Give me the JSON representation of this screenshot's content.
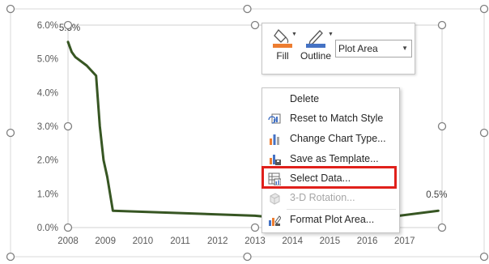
{
  "chart_data": {
    "type": "line",
    "x": [
      2008.0,
      2008.1,
      2008.2,
      2008.5,
      2008.75,
      2008.85,
      2008.95,
      2009.05,
      2009.2,
      2013.0,
      2013.5,
      2014.0,
      2016.5,
      2017.9
    ],
    "values": [
      5.5,
      5.2,
      5.05,
      4.8,
      4.5,
      3.0,
      2.0,
      1.5,
      0.5,
      0.35,
      0.3,
      0.3,
      0.3,
      0.5
    ],
    "series_color": "#375623",
    "xlim": [
      2008,
      2018
    ],
    "ylim": [
      0,
      6
    ],
    "x_ticks": [
      "2008",
      "2009",
      "2010",
      "2011",
      "2012",
      "2013",
      "2014",
      "2015",
      "2016",
      "2017"
    ],
    "y_ticks": [
      "0.0%",
      "1.0%",
      "2.0%",
      "3.0%",
      "4.0%",
      "5.0%",
      "6.0%"
    ],
    "data_labels": {
      "first": "5.5%",
      "last": "0.5%"
    },
    "grid": false
  },
  "mini_toolbar": {
    "fill_label": "Fill",
    "outline_label": "Outline",
    "element_select_value": "Plot Area",
    "fill_color": "#ed7d31",
    "outline_color": "#4472c4"
  },
  "context_menu": {
    "items": [
      {
        "label": "Delete",
        "icon": "none",
        "enabled": true
      },
      {
        "label": "Reset to Match Style",
        "icon": "reset-style-icon",
        "enabled": true
      },
      {
        "label": "Change Chart Type...",
        "icon": "chart-type-icon",
        "enabled": true
      },
      {
        "label": "Save as Template...",
        "icon": "save-template-icon",
        "enabled": true
      },
      {
        "label": "Select Data...",
        "icon": "select-data-icon",
        "enabled": true
      },
      {
        "label": "3-D Rotation...",
        "icon": "rotation-3d-icon",
        "enabled": false
      },
      {
        "label": "Format Plot Area...",
        "icon": "format-area-icon",
        "enabled": true
      }
    ]
  },
  "highlight_color": "#e0201b"
}
